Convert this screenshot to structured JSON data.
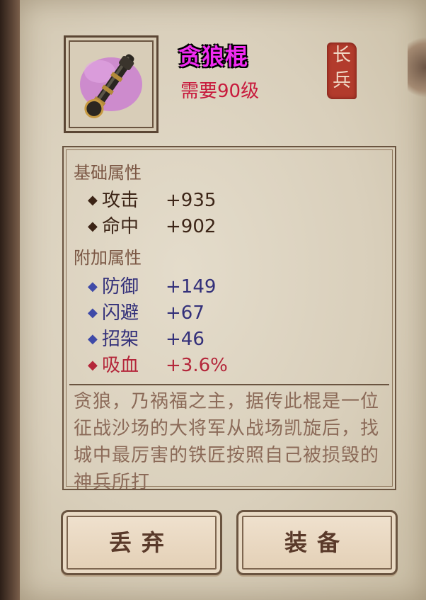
{
  "item": {
    "name": "贪狼棍",
    "level_req": "需要90级",
    "category": "长兵",
    "icon": "staff-weapon-icon"
  },
  "base_attributes": {
    "title": "基础属性",
    "stats": [
      {
        "name": "攻击",
        "value": "+935"
      },
      {
        "name": "命中",
        "value": "+902"
      }
    ]
  },
  "extra_attributes": {
    "title": "附加属性",
    "stats": [
      {
        "name": "防御",
        "value": "+149"
      },
      {
        "name": "闪避",
        "value": "+67"
      },
      {
        "name": "招架",
        "value": "+46"
      },
      {
        "name": "吸血",
        "value": "+3.6%"
      }
    ]
  },
  "description": "贪狼，乃祸福之主，据传此棍是一位征战沙场的大将军从战场凯旋后，找城中最厉害的铁匠按照自己被损毁的神兵所打",
  "buttons": {
    "drop": "丢弃",
    "equip": "装备"
  },
  "colors": {
    "item_name": "#f12bf1",
    "level_req": "#c8193c",
    "extra_stat": "#33307a",
    "lifesteal": "#b4263a"
  }
}
